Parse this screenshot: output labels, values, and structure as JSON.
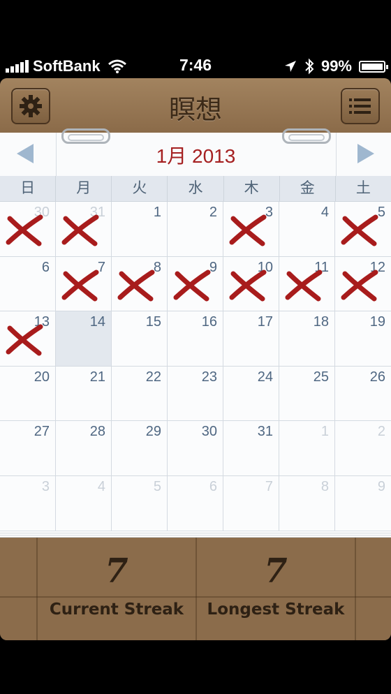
{
  "status_bar": {
    "carrier": "SoftBank",
    "time": "7:46",
    "battery": "99%",
    "battery_level": 0.99
  },
  "header": {
    "title": "瞑想",
    "settings_icon": "gear-icon",
    "menu_icon": "list-icon"
  },
  "calendar": {
    "month_title": "1月 2013",
    "weekdays": [
      "日",
      "月",
      "火",
      "水",
      "木",
      "金",
      "土"
    ],
    "cells": [
      {
        "day": "30",
        "other": true,
        "marked": true
      },
      {
        "day": "31",
        "other": true,
        "marked": true
      },
      {
        "day": "1",
        "other": false,
        "marked": false
      },
      {
        "day": "2",
        "other": false,
        "marked": false
      },
      {
        "day": "3",
        "other": false,
        "marked": true
      },
      {
        "day": "4",
        "other": false,
        "marked": false
      },
      {
        "day": "5",
        "other": false,
        "marked": true
      },
      {
        "day": "6",
        "other": false,
        "marked": false
      },
      {
        "day": "7",
        "other": false,
        "marked": true
      },
      {
        "day": "8",
        "other": false,
        "marked": true
      },
      {
        "day": "9",
        "other": false,
        "marked": true
      },
      {
        "day": "10",
        "other": false,
        "marked": true
      },
      {
        "day": "11",
        "other": false,
        "marked": true
      },
      {
        "day": "12",
        "other": false,
        "marked": true
      },
      {
        "day": "13",
        "other": false,
        "marked": true
      },
      {
        "day": "14",
        "other": false,
        "marked": false,
        "today": true
      },
      {
        "day": "15",
        "other": false,
        "marked": false
      },
      {
        "day": "16",
        "other": false,
        "marked": false
      },
      {
        "day": "17",
        "other": false,
        "marked": false
      },
      {
        "day": "18",
        "other": false,
        "marked": false
      },
      {
        "day": "19",
        "other": false,
        "marked": false
      },
      {
        "day": "20",
        "other": false,
        "marked": false
      },
      {
        "day": "21",
        "other": false,
        "marked": false
      },
      {
        "day": "22",
        "other": false,
        "marked": false
      },
      {
        "day": "23",
        "other": false,
        "marked": false
      },
      {
        "day": "24",
        "other": false,
        "marked": false
      },
      {
        "day": "25",
        "other": false,
        "marked": false
      },
      {
        "day": "26",
        "other": false,
        "marked": false
      },
      {
        "day": "27",
        "other": false,
        "marked": false
      },
      {
        "day": "28",
        "other": false,
        "marked": false
      },
      {
        "day": "29",
        "other": false,
        "marked": false
      },
      {
        "day": "30",
        "other": false,
        "marked": false
      },
      {
        "day": "31",
        "other": false,
        "marked": false
      },
      {
        "day": "1",
        "other": true,
        "marked": false
      },
      {
        "day": "2",
        "other": true,
        "marked": false
      },
      {
        "day": "3",
        "other": true,
        "marked": false
      },
      {
        "day": "4",
        "other": true,
        "marked": false
      },
      {
        "day": "5",
        "other": true,
        "marked": false
      },
      {
        "day": "6",
        "other": true,
        "marked": false
      },
      {
        "day": "7",
        "other": true,
        "marked": false
      },
      {
        "day": "8",
        "other": true,
        "marked": false
      },
      {
        "day": "9",
        "other": true,
        "marked": false
      }
    ],
    "mark_color": "#a81c1c",
    "accent_color": "#a52021"
  },
  "stats": {
    "current_streak_value": "7",
    "current_streak_label": "Current Streak",
    "longest_streak_value": "7",
    "longest_streak_label": "Longest Streak"
  }
}
